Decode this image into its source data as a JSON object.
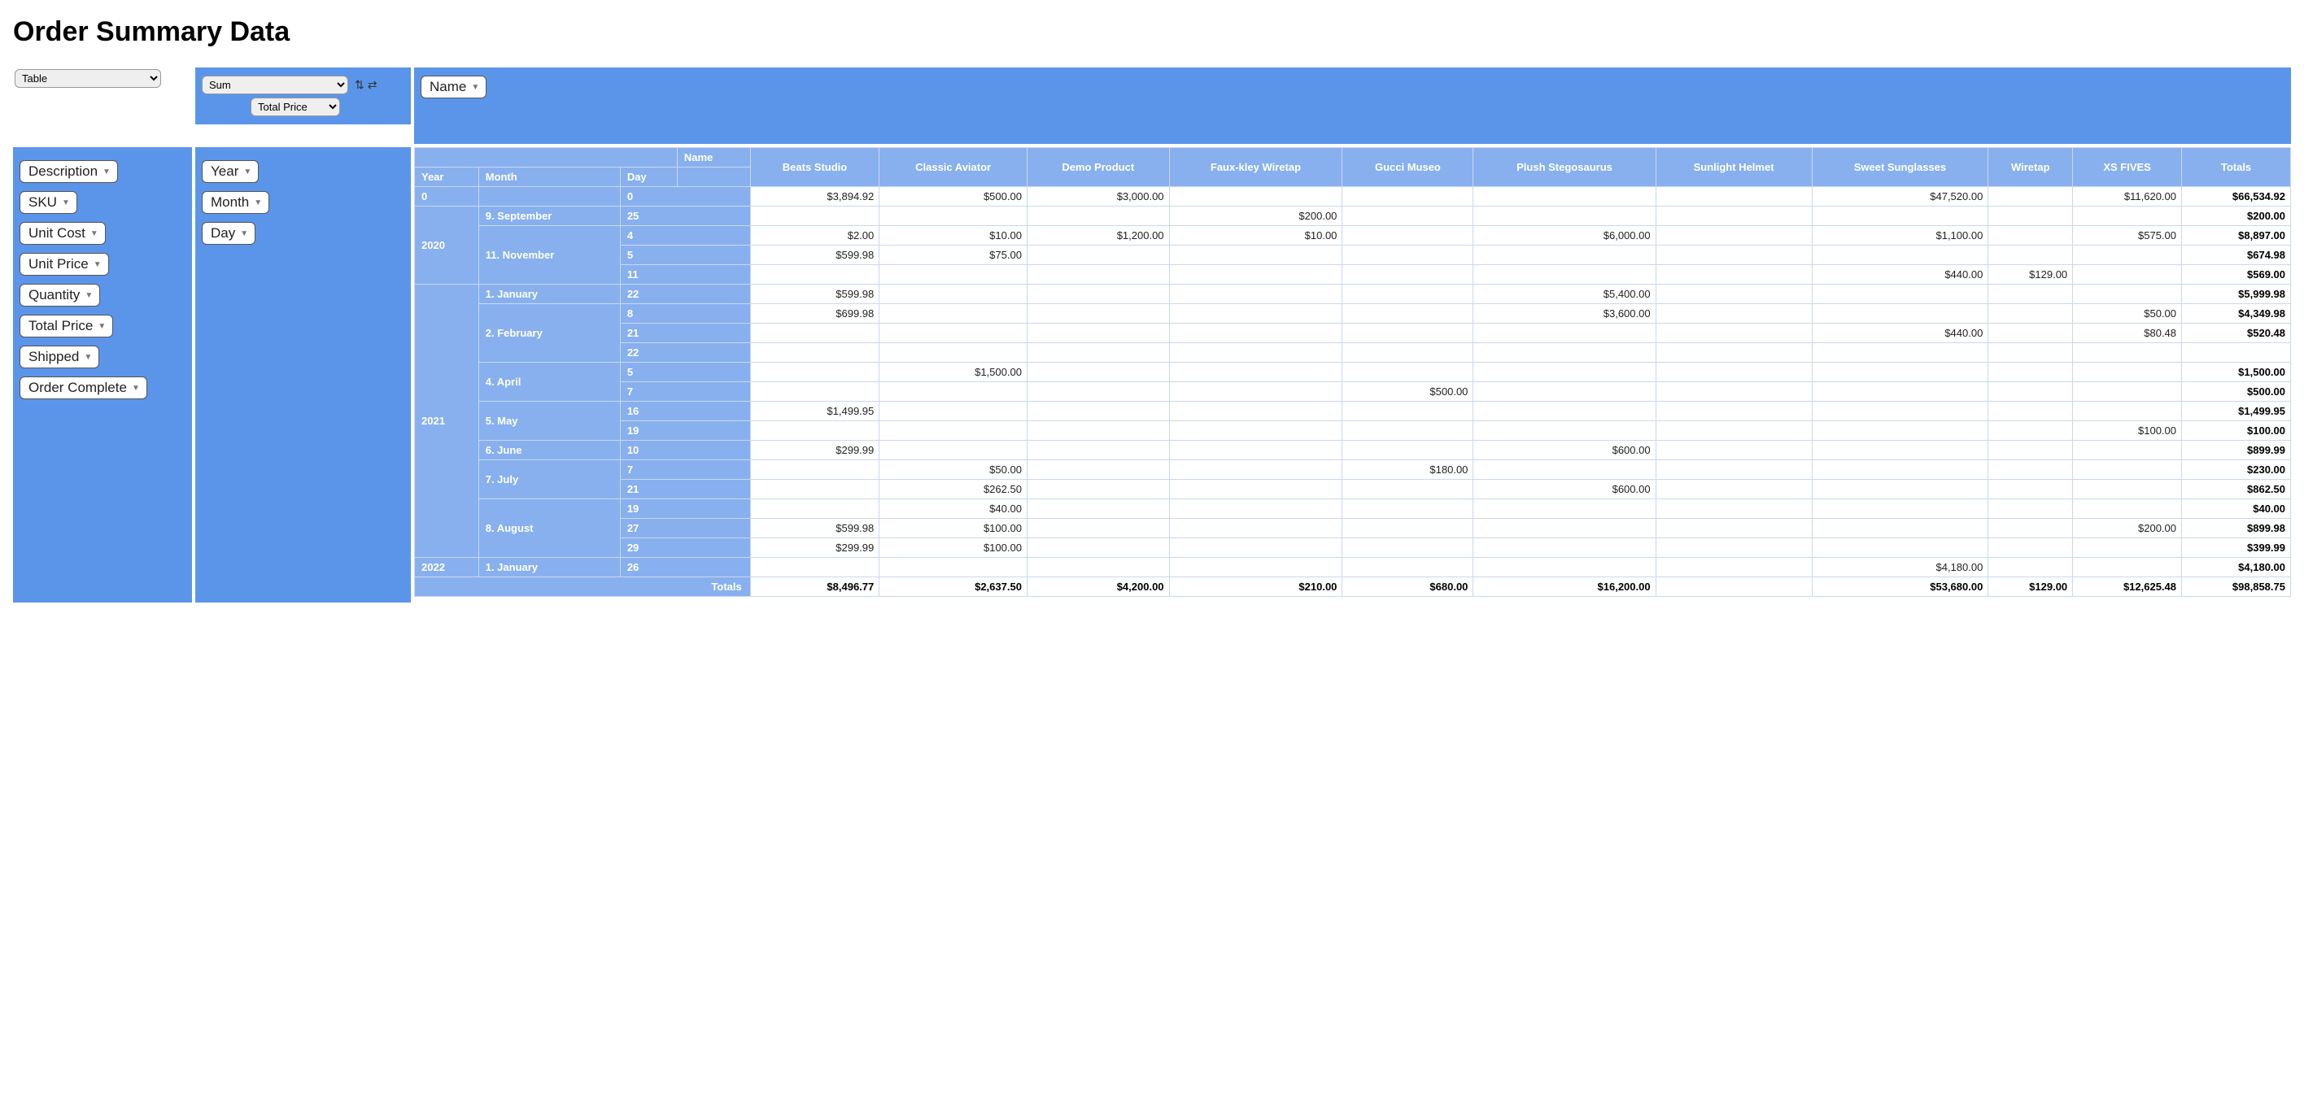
{
  "title": "Order Summary Data",
  "renderer_selected": "Table",
  "aggregator_selected": "Sum",
  "value_field_selected": "Total Price",
  "col_field_label": "Name",
  "unused_fields": [
    "Description",
    "SKU",
    "Unit Cost",
    "Unit Price",
    "Quantity",
    "Total Price",
    "Shipped",
    "Order Complete"
  ],
  "row_fields": [
    "Year",
    "Month",
    "Day"
  ],
  "pivot": {
    "corner_label": "Name",
    "row_axis_labels": [
      "Year",
      "Month",
      "Day"
    ],
    "col_headers": [
      "Beats Studio",
      "Classic Aviator",
      "Demo Product",
      "Faux-kley Wiretap",
      "Gucci Museo",
      "Plush Stegosaurus",
      "Sunlight Helmet",
      "Sweet Sunglasses",
      "Wiretap",
      "XS FIVES"
    ],
    "totals_label": "Totals",
    "row_groups": [
      {
        "year": "0",
        "months": [
          {
            "month": "",
            "days": [
              {
                "day": "0",
                "cells": [
                  "$3,894.92",
                  "$500.00",
                  "$3,000.00",
                  "",
                  "",
                  "",
                  "",
                  "$47,520.00",
                  "",
                  "$11,620.00"
                ],
                "total": "$66,534.92"
              }
            ]
          }
        ]
      },
      {
        "year": "2020",
        "months": [
          {
            "month": "9. September",
            "days": [
              {
                "day": "25",
                "cells": [
                  "",
                  "",
                  "",
                  "$200.00",
                  "",
                  "",
                  "",
                  "",
                  "",
                  ""
                ],
                "total": "$200.00"
              }
            ]
          },
          {
            "month": "11. November",
            "days": [
              {
                "day": "4",
                "cells": [
                  "$2.00",
                  "$10.00",
                  "$1,200.00",
                  "$10.00",
                  "",
                  "$6,000.00",
                  "",
                  "$1,100.00",
                  "",
                  "$575.00"
                ],
                "total": "$8,897.00"
              },
              {
                "day": "5",
                "cells": [
                  "$599.98",
                  "$75.00",
                  "",
                  "",
                  "",
                  "",
                  "",
                  "",
                  "",
                  ""
                ],
                "total": "$674.98"
              },
              {
                "day": "11",
                "cells": [
                  "",
                  "",
                  "",
                  "",
                  "",
                  "",
                  "",
                  "$440.00",
                  "$129.00",
                  ""
                ],
                "total": "$569.00"
              }
            ]
          }
        ]
      },
      {
        "year": "2021",
        "months": [
          {
            "month": "1. January",
            "days": [
              {
                "day": "22",
                "cells": [
                  "$599.98",
                  "",
                  "",
                  "",
                  "",
                  "$5,400.00",
                  "",
                  "",
                  "",
                  ""
                ],
                "total": "$5,999.98"
              }
            ]
          },
          {
            "month": "2. February",
            "days": [
              {
                "day": "8",
                "cells": [
                  "$699.98",
                  "",
                  "",
                  "",
                  "",
                  "$3,600.00",
                  "",
                  "",
                  "",
                  "$50.00"
                ],
                "total": "$4,349.98"
              },
              {
                "day": "21",
                "cells": [
                  "",
                  "",
                  "",
                  "",
                  "",
                  "",
                  "",
                  "$440.00",
                  "",
                  "$80.48"
                ],
                "total": "$520.48"
              },
              {
                "day": "22",
                "cells": [
                  "",
                  "",
                  "",
                  "",
                  "",
                  "",
                  "",
                  "",
                  "",
                  ""
                ],
                "total": ""
              }
            ]
          },
          {
            "month": "4. April",
            "days": [
              {
                "day": "5",
                "cells": [
                  "",
                  "$1,500.00",
                  "",
                  "",
                  "",
                  "",
                  "",
                  "",
                  "",
                  ""
                ],
                "total": "$1,500.00"
              },
              {
                "day": "7",
                "cells": [
                  "",
                  "",
                  "",
                  "",
                  "$500.00",
                  "",
                  "",
                  "",
                  "",
                  ""
                ],
                "total": "$500.00"
              }
            ]
          },
          {
            "month": "5. May",
            "days": [
              {
                "day": "16",
                "cells": [
                  "$1,499.95",
                  "",
                  "",
                  "",
                  "",
                  "",
                  "",
                  "",
                  "",
                  ""
                ],
                "total": "$1,499.95"
              },
              {
                "day": "19",
                "cells": [
                  "",
                  "",
                  "",
                  "",
                  "",
                  "",
                  "",
                  "",
                  "",
                  "$100.00"
                ],
                "total": "$100.00"
              }
            ]
          },
          {
            "month": "6. June",
            "days": [
              {
                "day": "10",
                "cells": [
                  "$299.99",
                  "",
                  "",
                  "",
                  "",
                  "$600.00",
                  "",
                  "",
                  "",
                  ""
                ],
                "total": "$899.99"
              }
            ]
          },
          {
            "month": "7. July",
            "days": [
              {
                "day": "7",
                "cells": [
                  "",
                  "$50.00",
                  "",
                  "",
                  "$180.00",
                  "",
                  "",
                  "",
                  "",
                  ""
                ],
                "total": "$230.00"
              },
              {
                "day": "21",
                "cells": [
                  "",
                  "$262.50",
                  "",
                  "",
                  "",
                  "$600.00",
                  "",
                  "",
                  "",
                  ""
                ],
                "total": "$862.50"
              }
            ]
          },
          {
            "month": "8. August",
            "days": [
              {
                "day": "19",
                "cells": [
                  "",
                  "$40.00",
                  "",
                  "",
                  "",
                  "",
                  "",
                  "",
                  "",
                  ""
                ],
                "total": "$40.00"
              },
              {
                "day": "27",
                "cells": [
                  "$599.98",
                  "$100.00",
                  "",
                  "",
                  "",
                  "",
                  "",
                  "",
                  "",
                  "$200.00"
                ],
                "total": "$899.98"
              },
              {
                "day": "29",
                "cells": [
                  "$299.99",
                  "$100.00",
                  "",
                  "",
                  "",
                  "",
                  "",
                  "",
                  "",
                  ""
                ],
                "total": "$399.99"
              }
            ]
          }
        ]
      },
      {
        "year": "2022",
        "months": [
          {
            "month": "1. January",
            "days": [
              {
                "day": "26",
                "cells": [
                  "",
                  "",
                  "",
                  "",
                  "",
                  "",
                  "",
                  "$4,180.00",
                  "",
                  ""
                ],
                "total": "$4,180.00"
              }
            ]
          }
        ]
      }
    ],
    "col_totals": [
      "$8,496.77",
      "$2,637.50",
      "$4,200.00",
      "$210.00",
      "$680.00",
      "$16,200.00",
      "",
      "$53,680.00",
      "$129.00",
      "$12,625.48"
    ],
    "grand_total": "$98,858.75"
  }
}
